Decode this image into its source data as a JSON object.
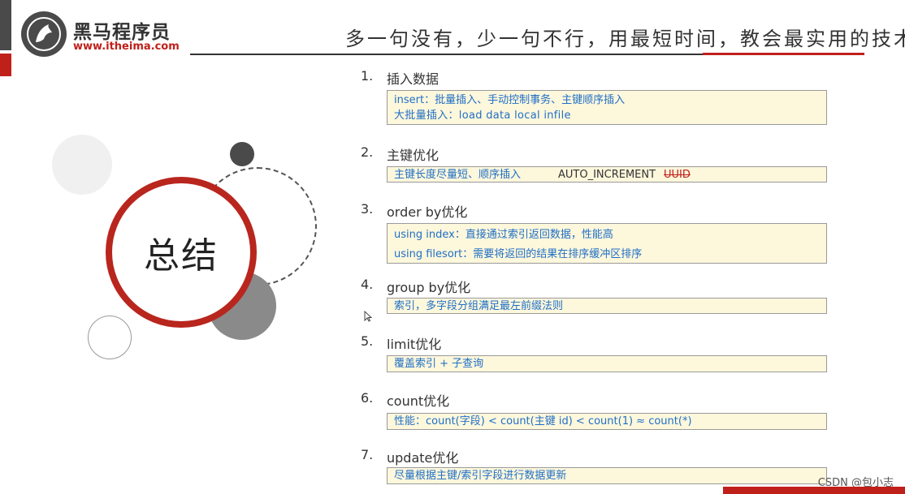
{
  "brand": {
    "name": "黑马程序员",
    "url": "www.itheima.com"
  },
  "slogan": "多一句没有，少一句不行，用最短时间，教会最实用的技术！",
  "summary_title": "总结",
  "items": [
    {
      "num": "1.",
      "title": "插入数据",
      "box_lines": [
        "insert：批量插入、手动控制事务、主键顺序插入",
        "大批量插入：load  data  local  infile"
      ]
    },
    {
      "num": "2.",
      "title": "主键优化",
      "box_lines": [
        "主键长度尽量短、顺序插入"
      ],
      "extra": "AUTO_INCREMENT",
      "struck": "UUID"
    },
    {
      "num": "3.",
      "title": "order by优化",
      "box_lines": [
        "using index：直接通过索引返回数据，性能高",
        "using filesort：需要将返回的结果在排序缓冲区排序"
      ]
    },
    {
      "num": "4.",
      "title": "group by优化",
      "box_lines": [
        "索引，多字段分组满足最左前缀法则"
      ]
    },
    {
      "num": "5.",
      "title": "limit优化",
      "box_lines": [
        "覆盖索引 + 子查询"
      ]
    },
    {
      "num": "6.",
      "title": "count优化",
      "box_lines": [
        "性能：count(字段) < count(主键 id) < count(1) ≈ count(*)"
      ]
    },
    {
      "num": "7.",
      "title": "update优化",
      "box_lines": [
        "尽量根据主键/索引字段进行数据更新"
      ]
    }
  ],
  "watermark": "CSDN @包小志",
  "colors": {
    "brand_red": "#c0201a",
    "box_bg": "#fdf7dc",
    "box_text": "#1f6fc7"
  }
}
